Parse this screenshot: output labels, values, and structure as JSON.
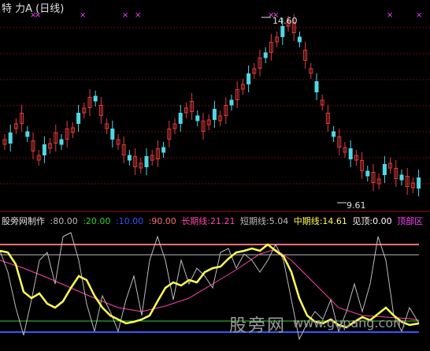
{
  "window": {
    "title": "特  力A (日线)"
  },
  "price": {
    "high_label": "14.60",
    "low_label": "9.61",
    "colors": {
      "up": "#e03b3b",
      "down": "#4fd8e6",
      "grid": "#7a1010",
      "text": "#e0e0e0"
    }
  },
  "indicator": {
    "name": "股旁网制作",
    "levels": [
      {
        "label": ":80.00",
        "color": "#bbbbbb"
      },
      {
        "label": ":20.00",
        "color": "#33cc33"
      },
      {
        "label": ":10.00",
        "color": "#3355ff"
      },
      {
        "label": ":90.00",
        "color": "#ff7070"
      }
    ],
    "series": [
      {
        "label": "长期线:21.21",
        "color": "#ff44aa"
      },
      {
        "label": "短期线:5.04",
        "color": "#bbbbbb"
      },
      {
        "label": "中期线:14.61",
        "color": "#ffff55"
      },
      {
        "label": "见顶:0.00",
        "color": "#ffffff"
      },
      {
        "label": "顶部区",
        "color": "#ff44ff"
      }
    ]
  },
  "watermark": {
    "cn": "股旁网",
    "en": "www.gupang.com"
  }
}
